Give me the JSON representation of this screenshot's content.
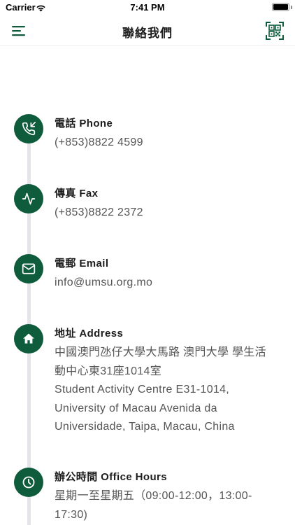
{
  "status_bar": {
    "carrier": "Carrier",
    "time": "7:41 PM"
  },
  "nav": {
    "title": "聯絡我們",
    "menu_icon": "hamburger-menu-icon",
    "qr_icon": "qr-code-icon"
  },
  "colors": {
    "accent": "#0f5c3c",
    "timeline": "#e4e4ea",
    "value_text": "#555555"
  },
  "contacts": {
    "phone": {
      "icon": "phone-incoming-icon",
      "title": "電話 Phone",
      "value": "(+853)8822 4599"
    },
    "fax": {
      "icon": "activity-pulse-icon",
      "title": "傳真 Fax",
      "value": "(+853)8822 2372"
    },
    "email": {
      "icon": "mail-icon",
      "title": "電郵 Email",
      "value": "info@umsu.org.mo"
    },
    "address": {
      "icon": "home-icon",
      "title": "地址 Address",
      "lines": [
        "中國澳門氹仔大學大馬路 澳門大學 學生活",
        "動中心東31座1014室",
        "Student Activity Centre E31-1014,",
        "University of Macau Avenida da",
        "Universidade, Taipa, Macau, China"
      ]
    },
    "hours": {
      "icon": "clock-icon",
      "title": "辦公時間 Office Hours",
      "lines": [
        "星期一至星期五（09:00-12:00，13:00-",
        "17:30)"
      ]
    }
  }
}
